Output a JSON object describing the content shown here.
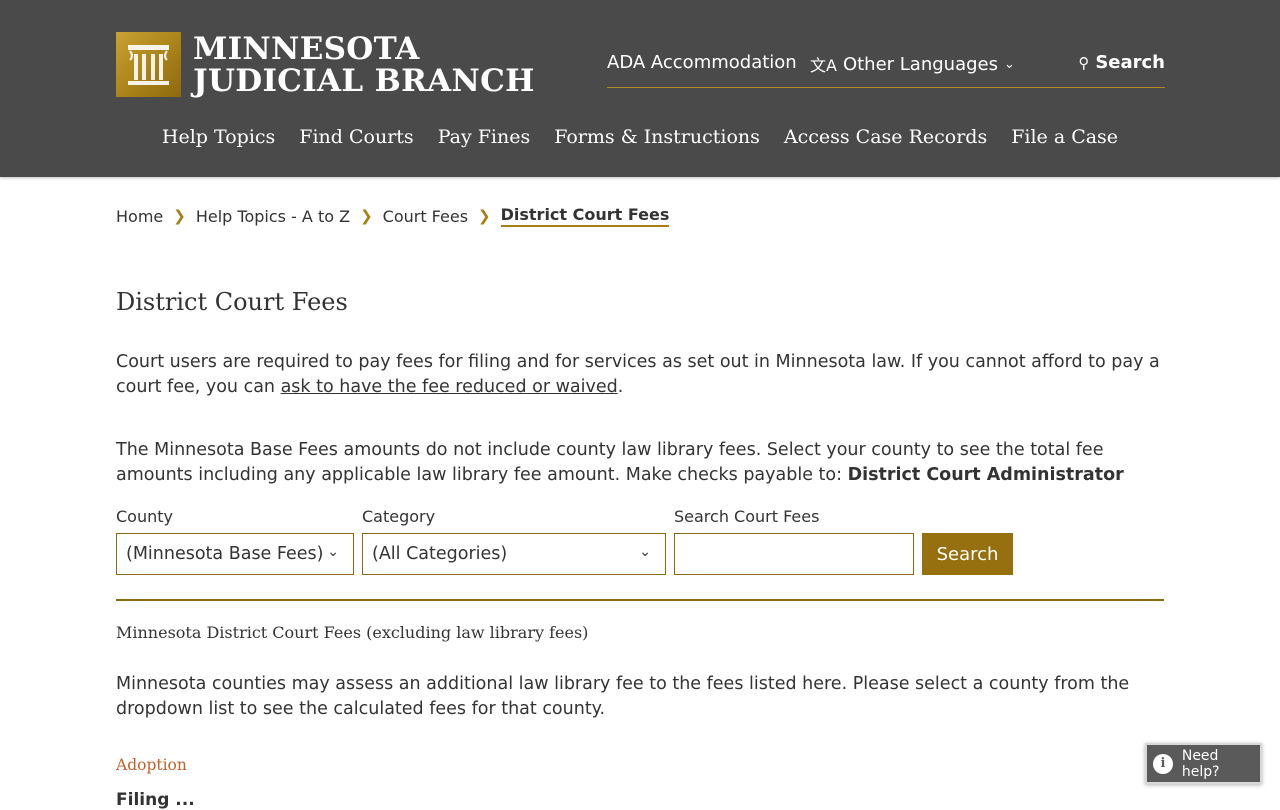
{
  "header": {
    "logo_line1": "MINNESOTA",
    "logo_line2": "JUDICIAL BRANCH",
    "utility": {
      "ada": "ADA Accommodation",
      "languages": "Other Languages",
      "search": "Search"
    },
    "nav": [
      "Help Topics",
      "Find Courts",
      "Pay Fines",
      "Forms & Instructions",
      "Access Case Records",
      "File a Case"
    ]
  },
  "breadcrumb": {
    "items": [
      "Home",
      "Help Topics - A to Z",
      "Court Fees"
    ],
    "current": "District Court Fees"
  },
  "main": {
    "title": "District Court Fees",
    "intro_text": "Court users are required to pay fees for filing and for services as set out in Minnesota law.  If you cannot afford to pay a court fee, you can ",
    "intro_link": "ask to have the fee reduced or waived",
    "intro_end": ".",
    "base_text": "The Minnesota Base Fees amounts do not include county law library fees. Select your county to see the total fee amounts including any applicable law library fee amount. Make checks payable to: ",
    "payable_to": "District Court Administrator",
    "filters": {
      "county_label": "County",
      "county_value": "(Minnesota Base Fees)",
      "category_label": "Category",
      "category_value": "(All Categories)",
      "search_label": "Search Court Fees",
      "search_value": "",
      "search_button": "Search"
    },
    "section_title": "Minnesota District Court Fees (excluding law library fees)",
    "section_text": "Minnesota counties may assess an additional law library fee to the fees listed here. Please select a county from the dropdown list to see the calculated fees for that county.",
    "category_heading": "Adoption",
    "partial_text": "Filing ..."
  },
  "help_widget": {
    "label": "Need help?"
  },
  "colors": {
    "header_bg": "#4a4a4a",
    "accent_gold": "#96700f",
    "category_orange": "#c0622a"
  }
}
